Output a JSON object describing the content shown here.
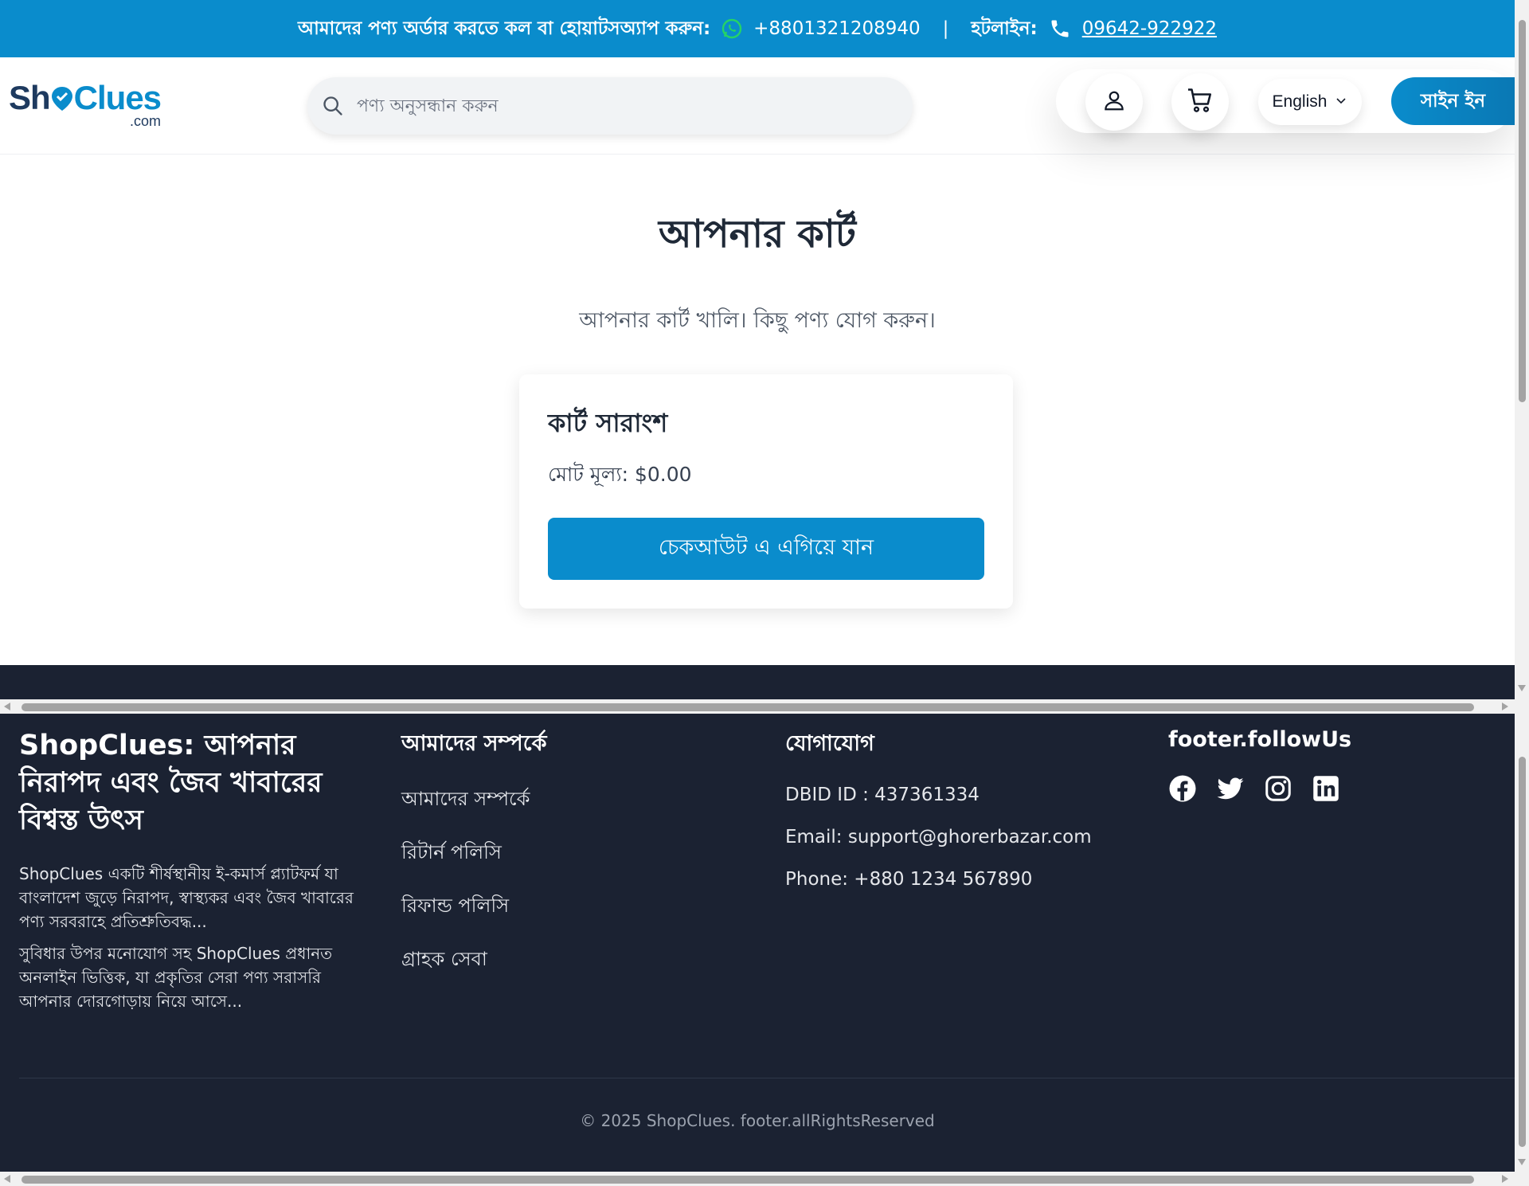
{
  "topbar": {
    "order_text": "আমাদের পণ্য অর্ডার করতে কল বা হোয়াটসঅ্যাপ করুন:",
    "whatsapp_number": "+8801321208940",
    "separator": "|",
    "hotline_label": "হটলাইন:",
    "hotline_number": "09642-922922",
    "icons": {
      "whatsapp": "whatsapp-icon",
      "phone": "phone-icon"
    }
  },
  "header": {
    "logo": {
      "part1": "Sh",
      "part2": "p",
      "part3": "Clues",
      "suffix": ".com"
    },
    "search": {
      "placeholder": "পণ্য অনুসন্ধান করুন",
      "value": "",
      "icon": "search-icon"
    },
    "icons": {
      "user": "user-icon",
      "cart": "cart-icon"
    },
    "language": {
      "selected": "English"
    },
    "signin_label": "সাইন ইন"
  },
  "main": {
    "title": "আপনার কার্ট",
    "empty_message": "আপনার কার্ট খালি। কিছু পণ্য যোগ করুন।",
    "summary": {
      "title": "কার্ট সারাংশ",
      "total": "মোট মূল্য: $0.00",
      "checkout_label": "চেকআউট এ এগিয়ে যান"
    }
  },
  "footer": {
    "brand": {
      "title": "ShopClues: আপনার নিরাপদ এবং জৈব খাবারের বিশ্বস্ত উৎস",
      "desc1": "ShopClues একটি শীর্ষস্থানীয় ই-কমার্স প্ল্যাটফর্ম যা বাংলাদেশ জুড়ে নিরাপদ, স্বাস্থ্যকর এবং জৈব খাবারের পণ্য সরবরাহে প্রতিশ্রুতিবদ্ধ...",
      "desc2": "সুবিধার উপর মনোযোগ সহ ShopClues প্রধানত অনলাইন ভিত্তিক, যা প্রকৃতির সেরা পণ্য সরাসরি আপনার দোরগোড়ায় নিয়ে আসে..."
    },
    "about": {
      "heading": "আমাদের সম্পর্কে",
      "links": [
        "আমাদের সম্পর্কে",
        "রিটার্ন পলিসি",
        "রিফান্ড পলিসি",
        "গ্রাহক সেবা"
      ]
    },
    "contact": {
      "heading": "যোগাযোগ",
      "dbid": "DBID ID : 437361334",
      "email": "Email: support@ghorerbazar.com",
      "phone": "Phone: +880 1234 567890"
    },
    "follow": {
      "heading": "footer.followUs",
      "icons": [
        "facebook-icon",
        "twitter-icon",
        "instagram-icon",
        "linkedin-icon"
      ]
    },
    "copyright": "© 2025 ShopClues. footer.allRightsReserved"
  },
  "colors": {
    "brand_blue": "#0a8ccc",
    "logo_navy": "#1e3a5f",
    "footer_bg": "#1b2232"
  }
}
